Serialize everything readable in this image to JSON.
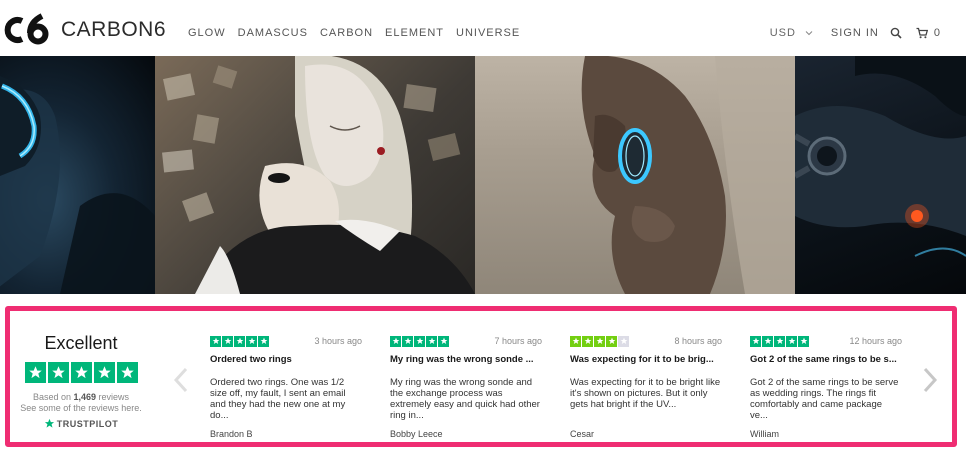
{
  "header": {
    "brand": "CARBON6",
    "nav": [
      "GLOW",
      "DAMASCUS",
      "CARBON",
      "ELEMENT",
      "UNIVERSE"
    ],
    "currency": "USD",
    "sign_in": "SIGN IN",
    "cart_count": "0"
  },
  "hero": {
    "panels": [
      "glowing-ring-on-dark-hand",
      "woman-wearing-black-ring",
      "hand-with-glowing-ring",
      "watch-and-glowing-light"
    ]
  },
  "trustpilot": {
    "rating_word": "Excellent",
    "based_on_prefix": "Based on ",
    "review_count": "1,469",
    "based_on_suffix": " reviews",
    "see_some": "See some of the reviews here.",
    "logo_text": "TRUSTPILOT",
    "colors": {
      "star_green": "#00b67a",
      "star_lime": "#73cf11",
      "star_empty": "#dcdce6",
      "frame": "#ef2d72"
    },
    "reviews": [
      {
        "stars": 5,
        "time": "3 hours ago",
        "title": "Ordered two rings",
        "text": "Ordered two rings. One was 1/2 size off, my fault, I sent an email and they had the new one at my do...",
        "author": "Brandon B"
      },
      {
        "stars": 5,
        "time": "7 hours ago",
        "title": "My ring was the wrong sonde ...",
        "text": "My ring was the wrong sonde and the exchange process was extremely easy and quick had other ring in...",
        "author": "Bobby Leece"
      },
      {
        "stars": 4,
        "time": "8 hours ago",
        "title": "Was expecting for it to be brig...",
        "text": "Was expecting for it to be bright like it's shown on pictures. But it only gets hat bright if the UV...",
        "author": "Cesar"
      },
      {
        "stars": 5,
        "time": "12 hours ago",
        "title": "Got 2 of the same rings to be s...",
        "text": "Got 2 of the same rings to be serve as wedding rings. The rings fit comfortably and came package ve...",
        "author": "William"
      }
    ]
  }
}
